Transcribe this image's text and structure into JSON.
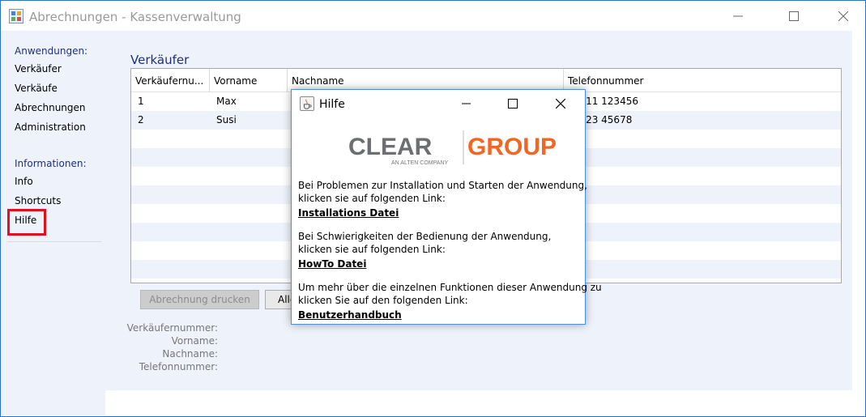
{
  "window": {
    "title": "Abrechnungen - Kassenverwaltung"
  },
  "sidebar": {
    "apps_heading": "Anwendungen:",
    "apps": [
      "Verkäufer",
      "Verkäufe",
      "Abrechnungen",
      "Administration"
    ],
    "info_heading": "Informationen:",
    "info": [
      "Info",
      "Shortcuts",
      "Hilfe"
    ],
    "selected": "Hilfe"
  },
  "main": {
    "section_title": "Verkäufer",
    "table": {
      "columns": [
        "Verkäufernu...",
        "Vorname",
        "Nachname",
        "Telefonnummer"
      ],
      "rows": [
        [
          "1",
          "Max",
          "",
          "...111 123456"
        ],
        [
          "2",
          "Susi",
          "",
          "...123 45678"
        ]
      ]
    },
    "buttons": {
      "print": "Abrechnung drucken",
      "all": "Alle"
    },
    "details": {
      "nr_label": "Verkäufernummer:",
      "vorname_label": "Vorname:",
      "nachname_label": "Nachname:",
      "tel_label": "Telefonnummer:"
    }
  },
  "dialog": {
    "title": "Hilfe",
    "logo": {
      "clear": "CLEAR",
      "group": "GROUP",
      "tagline": "AN ALTEN COMPANY"
    },
    "p1_line1": "Bei Problemen zur Installation und Starten der Anwendung,",
    "p1_line2": "klicken sie auf folgenden Link:",
    "link1": "Installations Datei",
    "p2_line1": "Bei Schwierigkeiten der Bedienung der Anwendung,",
    "p2_line2": "klicken sie auf folgenden Link:",
    "link2": "HowTo Datei",
    "p3_line1": "Um mehr über die einzelnen Funktionen dieser Anwendung zu",
    "p3_line2": "klicken Sie auf den folgenden Link:",
    "link3": "Benutzerhandbuch"
  },
  "colors": {
    "accent": "#1e2f83",
    "highlight_border": "#e3101e",
    "logo_gray": "#6d6e71",
    "logo_orange": "#f26522"
  }
}
